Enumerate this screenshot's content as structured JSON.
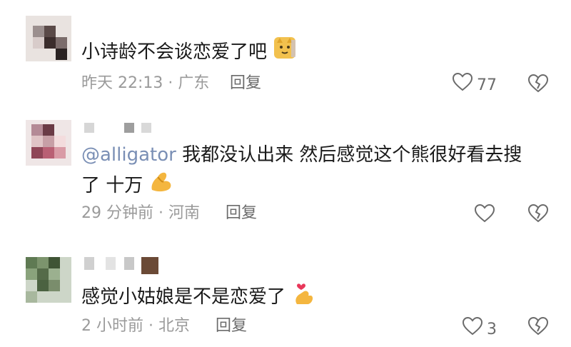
{
  "comments": [
    {
      "text": "小诗龄不会谈恋爱了吧",
      "emoji": "cat-face-icon",
      "time_location": "昨天 22:13 · 广东",
      "reply_label": "回复",
      "like_count": "77"
    },
    {
      "mention": "@alligator",
      "text_line1": "我都没认出来 然后感觉这个熊很好看去搜",
      "text_line2": "了 十万",
      "emoji": "pinching-hand-icon",
      "time_location": "29 分钟前 · 河南",
      "reply_label": "回复",
      "like_count": ""
    },
    {
      "text": "感觉小姑娘是不是恋爱了",
      "emoji": "hand-heart-icon",
      "time_location": "2 小时前 · 北京",
      "reply_label": "回复",
      "like_count": "3"
    }
  ],
  "colors": {
    "text": "#1a1a1a",
    "meta": "#9a9a9a",
    "icon": "#6b6b6b",
    "mention": "#7a8fb5"
  }
}
